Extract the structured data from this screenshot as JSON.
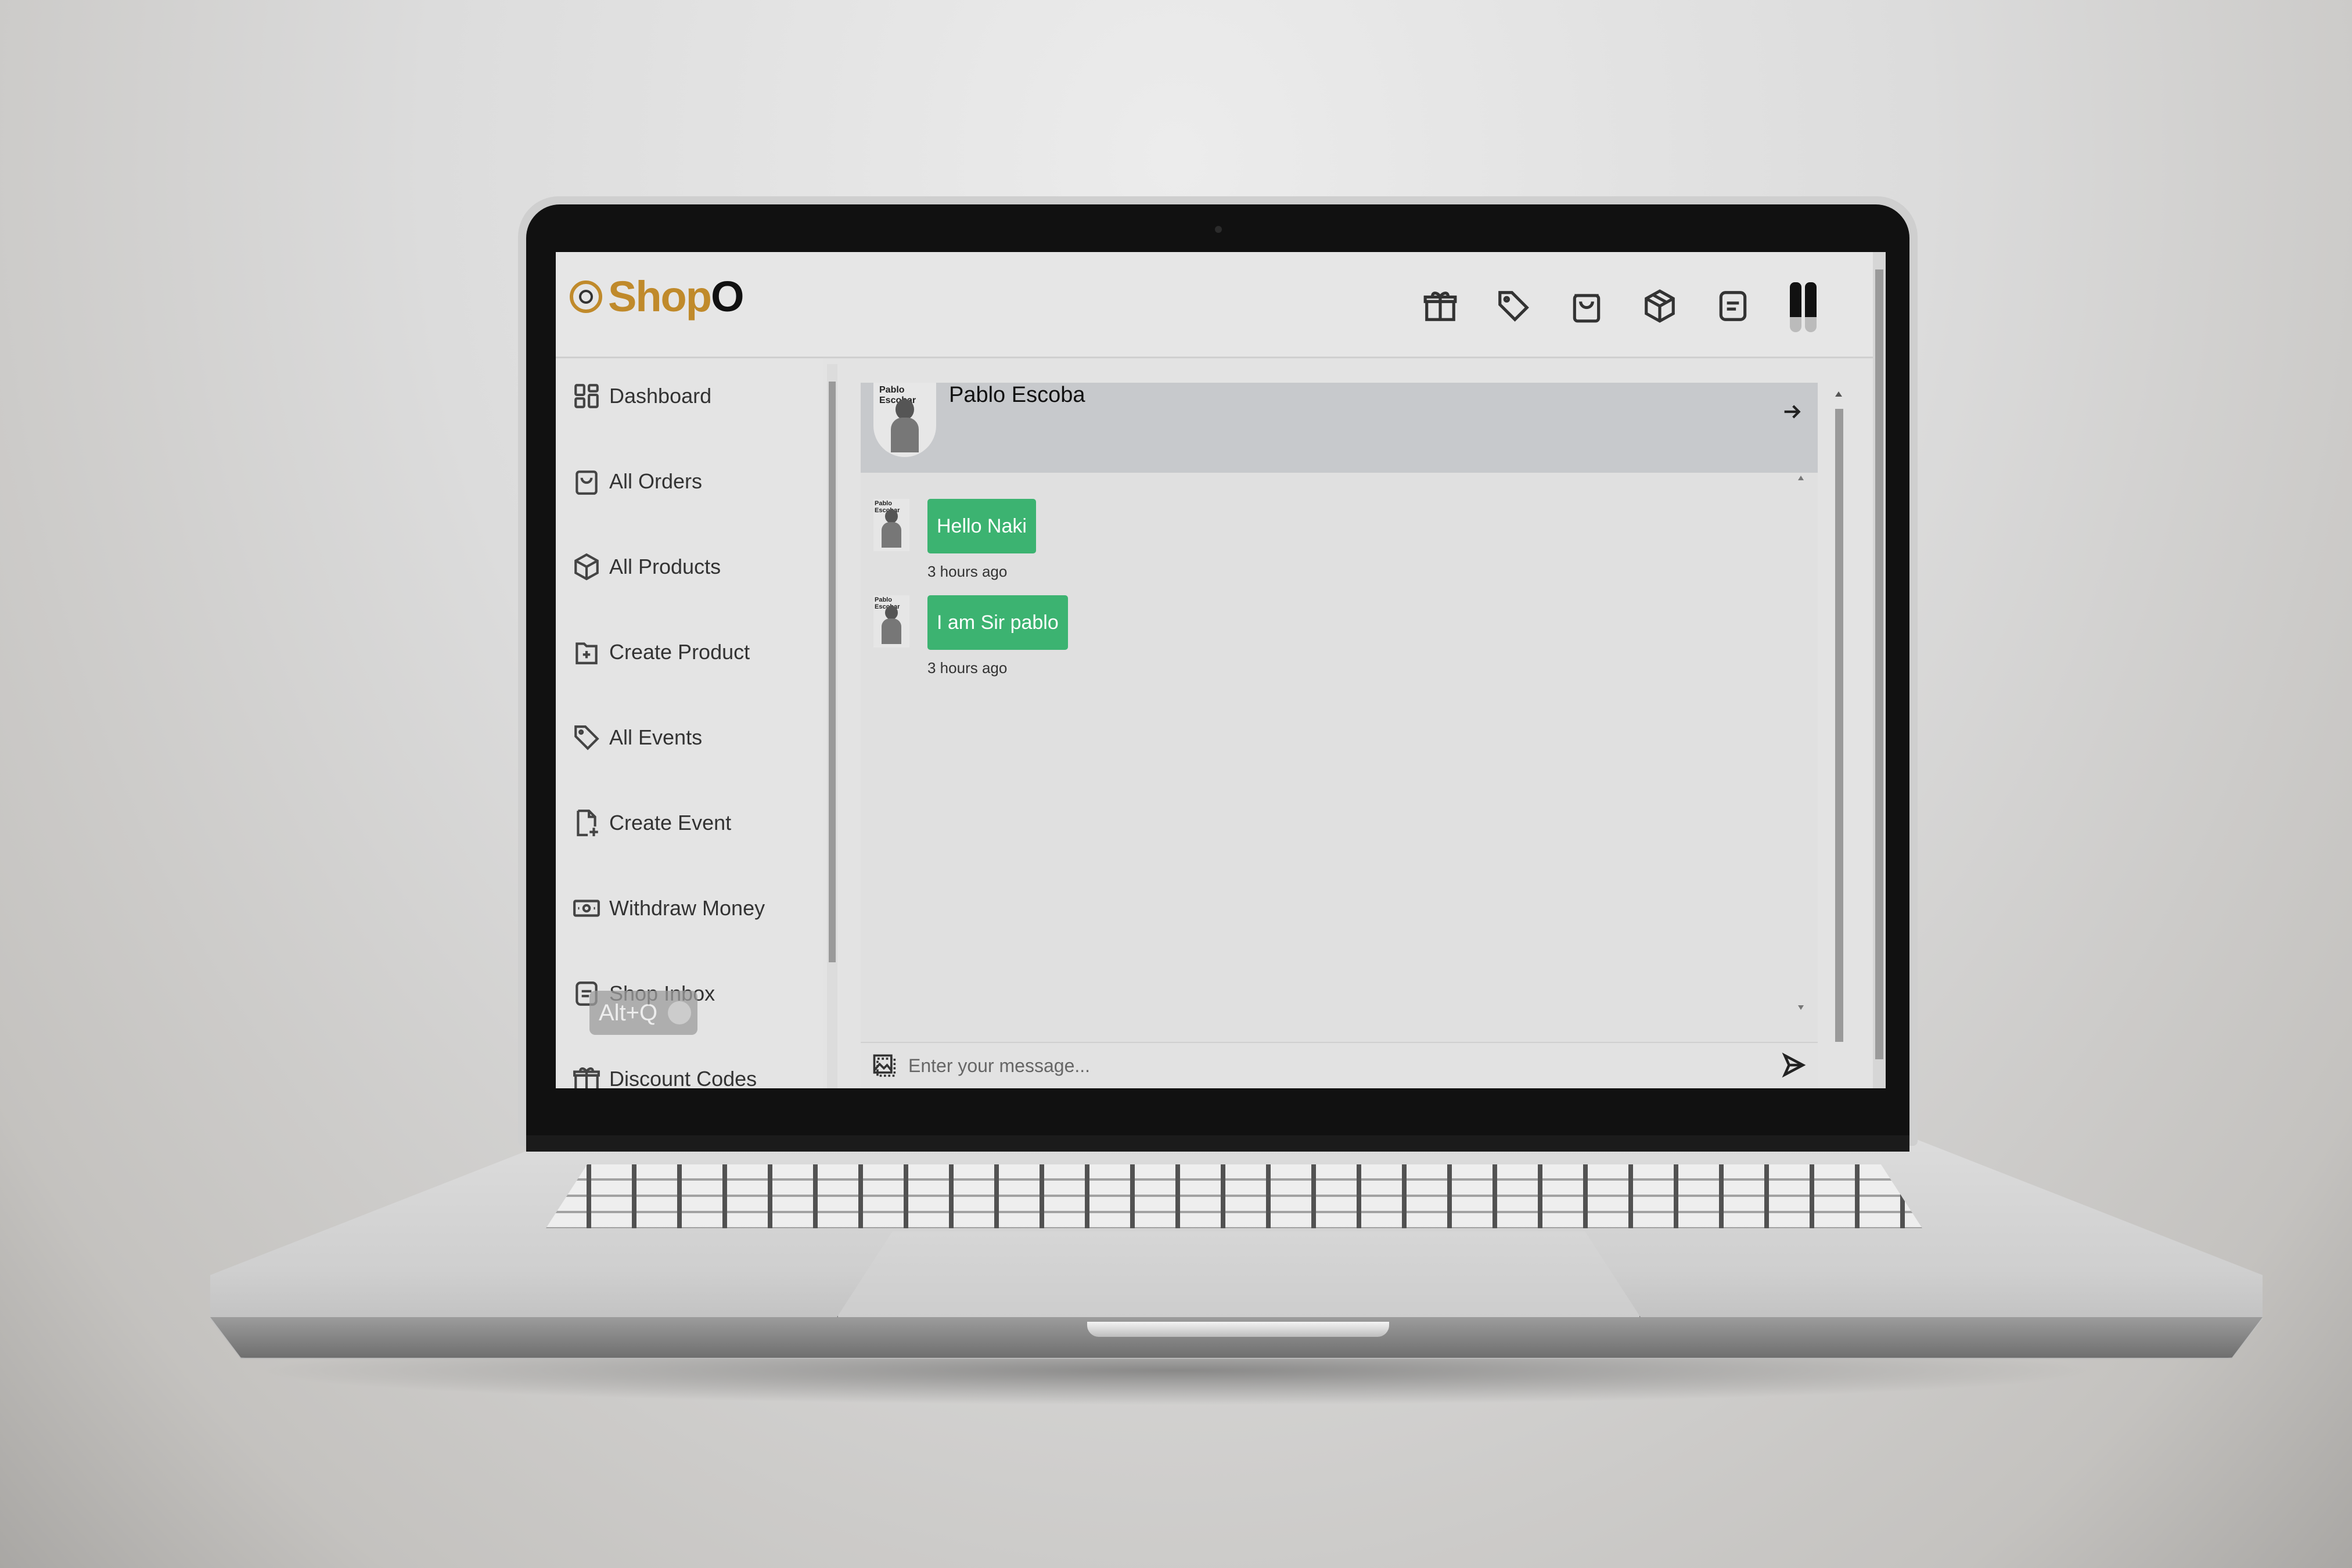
{
  "app": {
    "logo_text_main": "Shop",
    "logo_text_accent": "O"
  },
  "header": {
    "icons": [
      "gift-icon",
      "tag-icon",
      "shopping-bag-icon",
      "package-icon",
      "message-square-icon",
      "user-avatar"
    ]
  },
  "sidebar": {
    "items": [
      {
        "label": "Dashboard",
        "icon": "dashboard-grid-icon"
      },
      {
        "label": "All Orders",
        "icon": "shopping-bag-icon"
      },
      {
        "label": "All Products",
        "icon": "package-icon"
      },
      {
        "label": "Create Product",
        "icon": "file-plus-icon"
      },
      {
        "label": "All Events",
        "icon": "tag-icon"
      },
      {
        "label": "Create Event",
        "icon": "document-add-icon"
      },
      {
        "label": "Withdraw Money",
        "icon": "cash-icon"
      },
      {
        "label": "Shop Inbox",
        "icon": "message-square-icon"
      },
      {
        "label": "Discount Codes",
        "icon": "gift-icon"
      }
    ],
    "shortcut_badge": "Alt+Q"
  },
  "chat": {
    "contact_name": "Pablo Escoba",
    "avatar_caption": "Pablo Escobar",
    "messages": [
      {
        "text": "Hello Naki",
        "time": "3 hours ago"
      },
      {
        "text": "I am Sir pablo",
        "time": "3 hours ago"
      }
    ],
    "composer_placeholder": "Enter your message..."
  },
  "colors": {
    "brand": "#c08a2b",
    "bubble": "#3cb371",
    "chat_header": "#c7c9cc"
  }
}
